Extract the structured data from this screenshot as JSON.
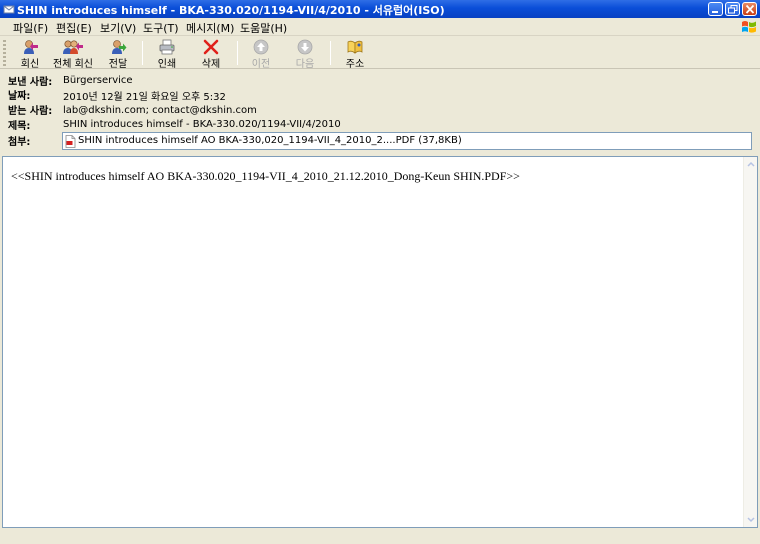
{
  "window": {
    "title": "SHIN introduces himself - BKA-330.020/1194-VII/4/2010  - 서유럽어(ISO)"
  },
  "menu": {
    "items": [
      {
        "label": "파일(F)"
      },
      {
        "label": "편집(E)"
      },
      {
        "label": "보기(V)"
      },
      {
        "label": "도구(T)"
      },
      {
        "label": "메시지(M)"
      },
      {
        "label": "도움말(H)"
      }
    ]
  },
  "toolbar": {
    "reply": "회신",
    "reply_all": "전체 회신",
    "forward": "전달",
    "print": "인쇄",
    "delete": "삭제",
    "previous": "이전",
    "next": "다음",
    "addresses": "주소"
  },
  "header": {
    "from_label": "보낸 사람:",
    "from_value": "Bürgerservice",
    "date_label": "날짜:",
    "date_value": "2010년 12월 21일 화요일 오후 5:32",
    "to_label": "받는 사람:",
    "to_value": "lab@dkshin.com; contact@dkshin.com",
    "subject_label": "제목:",
    "subject_value": "SHIN introduces himself - BKA-330.020/1194-VII/4/2010",
    "attach_label": "첨부:",
    "attach_value": "SHIN introduces himself AO BKA-330,020_1194-VII_4_2010_2....PDF (37,8KB)"
  },
  "body": {
    "text": "<<SHIN introduces himself AO BKA-330.020_1194-VII_4_2010_21.12.2010_Dong-Keun SHIN.PDF>>"
  },
  "icons": {
    "title": "mail-icon",
    "attachment": "pdf-file-icon"
  },
  "colors": {
    "titlebar": "#0a4ed8",
    "window_bg": "#ece9d8",
    "close_button": "#c83c14",
    "delete_icon": "#e0201a"
  }
}
